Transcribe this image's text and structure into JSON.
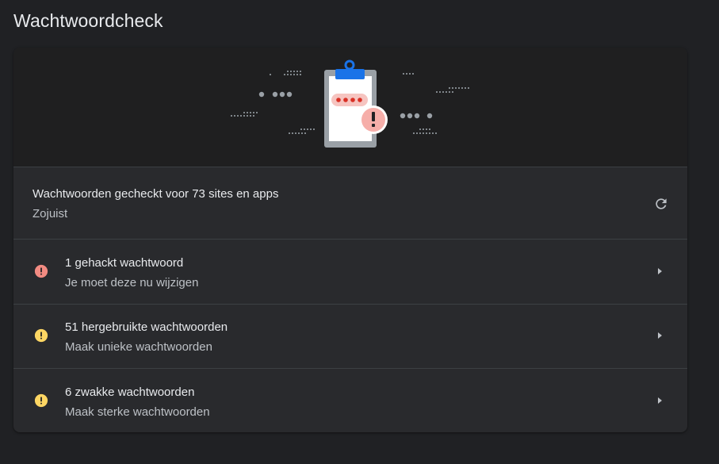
{
  "page": {
    "title": "Wachtwoordcheck"
  },
  "status": {
    "title": "Wachtwoorden gecheckt voor 73 sites en apps",
    "subtitle": "Zojuist",
    "refresh_icon": "refresh-icon"
  },
  "issues": [
    {
      "title": "1 gehackt wachtwoord",
      "subtitle": "Je moet deze nu wijzigen",
      "icon": "error-icon",
      "color": "#f28b82"
    },
    {
      "title": "51 hergebruikte wachtwoorden",
      "subtitle": "Maak unieke wachtwoorden",
      "icon": "warning-icon",
      "color": "#fdd663"
    },
    {
      "title": "6 zwakke wachtwoorden",
      "subtitle": "Maak sterke wachtwoorden",
      "icon": "warning-icon",
      "color": "#fdd663"
    }
  ],
  "illustration": {
    "icon": "clipboard-password-alert-icon"
  },
  "colors": {
    "background": "#202124",
    "card": "#292a2d",
    "banner": "#1f1f20",
    "clipboard_clip": "#1a73e8",
    "alert_red": "#f28b82",
    "warning_yellow": "#fdd663"
  }
}
